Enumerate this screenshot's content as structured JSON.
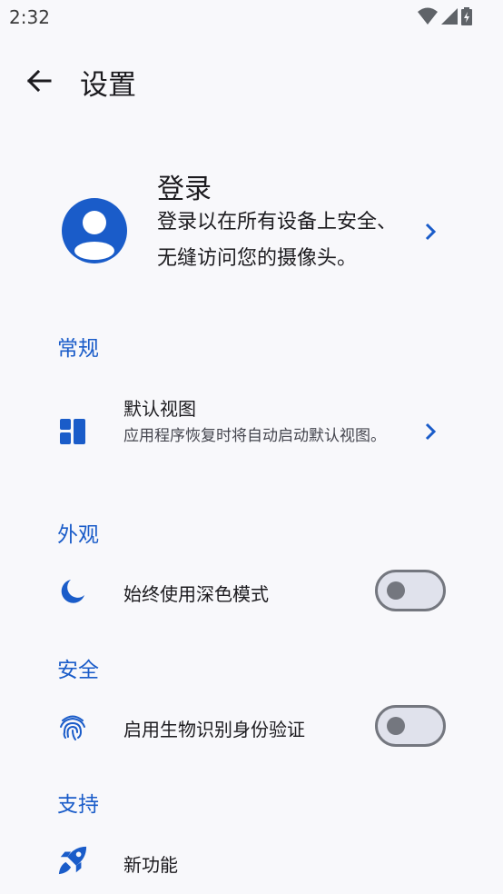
{
  "status_bar": {
    "time": "2:32"
  },
  "app_bar": {
    "title": "设置"
  },
  "signin": {
    "title": "登录",
    "description": "登录以在所有设备上安全、无缝访问您的摄像头。"
  },
  "sections": {
    "general": {
      "header": "常规",
      "default_view": {
        "title": "默认视图",
        "subtitle": "应用程序恢复时将自动启动默认视图。"
      }
    },
    "appearance": {
      "header": "外观",
      "dark_mode": {
        "title": "始终使用深色模式",
        "enabled": false
      }
    },
    "security": {
      "header": "安全",
      "biometric": {
        "title": "启用生物识别身份验证",
        "enabled": false
      }
    },
    "support": {
      "header": "支持",
      "whats_new": {
        "title": "新功能"
      }
    }
  },
  "colors": {
    "accent": "#1a5cc9",
    "background": "#f8f8fb",
    "switch_track": "#e0e2ec",
    "switch_outline": "#74777f"
  },
  "icons": {
    "back": "arrow-left-icon",
    "account": "account-circle-icon",
    "chevron": "chevron-right-icon",
    "default_view": "dashboard-icon",
    "dark_mode": "moon-icon",
    "biometric": "fingerprint-icon",
    "whats_new": "rocket-icon"
  }
}
